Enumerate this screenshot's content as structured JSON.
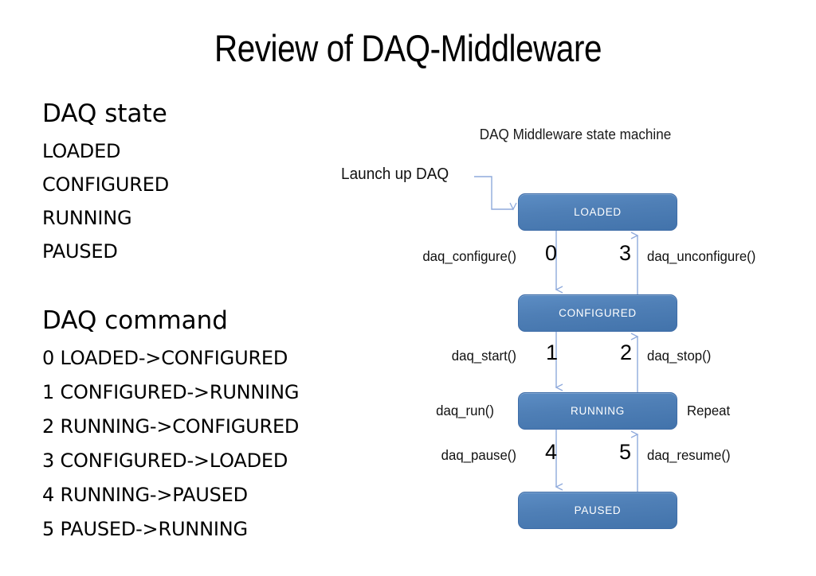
{
  "slide": {
    "title": "Review of DAQ-Middleware"
  },
  "states_section": {
    "heading": "DAQ state",
    "items": [
      "LOADED",
      "CONFIGURED",
      "RUNNING",
      "PAUSED"
    ]
  },
  "commands_section": {
    "heading": "DAQ command",
    "items": [
      "0 LOADED->CONFIGURED",
      "1 CONFIGURED->RUNNING",
      "2 RUNNING->CONFIGURED",
      "3 CONFIGURED->LOADED",
      "4 RUNNING->PAUSED",
      "5 PAUSED->RUNNING"
    ]
  },
  "diagram": {
    "caption": "DAQ Middleware state machine",
    "launch_label": "Launch up DAQ",
    "repeat_label": "Repeat",
    "run_label": "daq_run()",
    "nodes": [
      {
        "id": "loaded",
        "label": "LOADED"
      },
      {
        "id": "configured",
        "label": "CONFIGURED"
      },
      {
        "id": "running",
        "label": "RUNNING"
      },
      {
        "id": "paused",
        "label": "PAUSED"
      }
    ],
    "transitions": [
      {
        "number": "0",
        "label": "daq_configure()",
        "from": "LOADED",
        "to": "CONFIGURED",
        "direction": "down",
        "side": "left"
      },
      {
        "number": "3",
        "label": "daq_unconfigure()",
        "from": "CONFIGURED",
        "to": "LOADED",
        "direction": "up",
        "side": "right"
      },
      {
        "number": "1",
        "label": "daq_start()",
        "from": "CONFIGURED",
        "to": "RUNNING",
        "direction": "down",
        "side": "left"
      },
      {
        "number": "2",
        "label": "daq_stop()",
        "from": "RUNNING",
        "to": "CONFIGURED",
        "direction": "up",
        "side": "right"
      },
      {
        "number": "4",
        "label": "daq_pause()",
        "from": "RUNNING",
        "to": "PAUSED",
        "direction": "down",
        "side": "left"
      },
      {
        "number": "5",
        "label": "daq_resume()",
        "from": "PAUSED",
        "to": "RUNNING",
        "direction": "up",
        "side": "right"
      }
    ],
    "colors": {
      "box_fill": "#4f7fb6",
      "box_border": "#3f6da8",
      "box_text": "#ffffff",
      "arrow": "#8faadc",
      "background": "#ffffff"
    }
  }
}
